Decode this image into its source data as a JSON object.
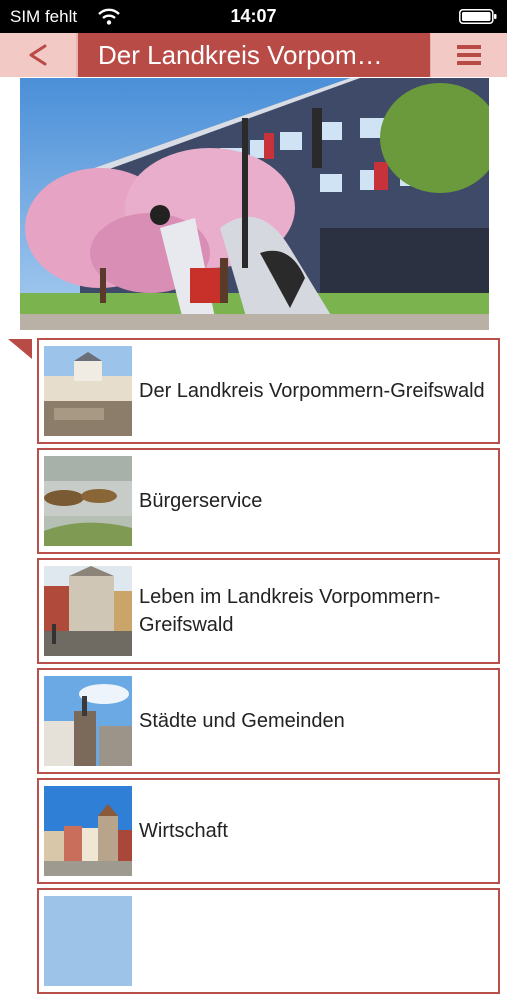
{
  "status_bar": {
    "carrier": "SIM fehlt",
    "time": "14:07"
  },
  "nav": {
    "title": "Der Landkreis Vorpom…",
    "back_label": "<"
  },
  "menu_items": [
    {
      "label": "Der Landkreis Vorpommern-Greifswald"
    },
    {
      "label": "Bürgerservice"
    },
    {
      "label": "Leben im Landkreis Vorpommern-Greifswald"
    },
    {
      "label": "Städte und Gemeinden"
    },
    {
      "label": "Wirtschaft"
    }
  ],
  "colors": {
    "accent": "#b94b47",
    "accent_light": "#f2c9c4",
    "border": "#b9504c"
  }
}
